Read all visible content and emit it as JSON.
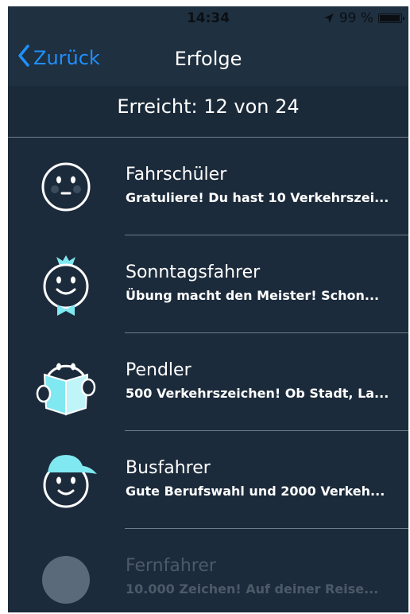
{
  "status_bar": {
    "time": "14:34",
    "battery_percent": "99 %",
    "battery_level": 0.99,
    "location_icon": "location-arrow-icon"
  },
  "nav": {
    "back_label": "Zurück",
    "title": "Erfolge"
  },
  "summary": {
    "text": "Erreicht: 12 von 24"
  },
  "achievements": [
    {
      "title": "Fahrschüler",
      "subtitle": "Gratuliere! Du hast 10 Verkehrszei...",
      "icon": "blushing-face-icon",
      "unlocked": true
    },
    {
      "title": "Sonntagsfahrer",
      "subtitle": "Übung macht den Meister! Schon...",
      "icon": "bowtie-face-icon",
      "unlocked": true
    },
    {
      "title": "Pendler",
      "subtitle": "500 Verkehrszeichen! Ob Stadt, La...",
      "icon": "newspaper-face-icon",
      "unlocked": true
    },
    {
      "title": "Busfahrer",
      "subtitle": "Gute Berufswahl und 2000 Verkeh...",
      "icon": "cap-face-icon",
      "unlocked": true
    },
    {
      "title": "Fernfahrer",
      "subtitle": "10.000 Zeichen! Auf deiner Reise...",
      "icon": "locked-circle-icon",
      "unlocked": false
    }
  ],
  "colors": {
    "background": "#1c2b3b",
    "accent": "#1e90ff",
    "icon_highlight": "#7fe8f0",
    "locked": "#4c5a68"
  }
}
